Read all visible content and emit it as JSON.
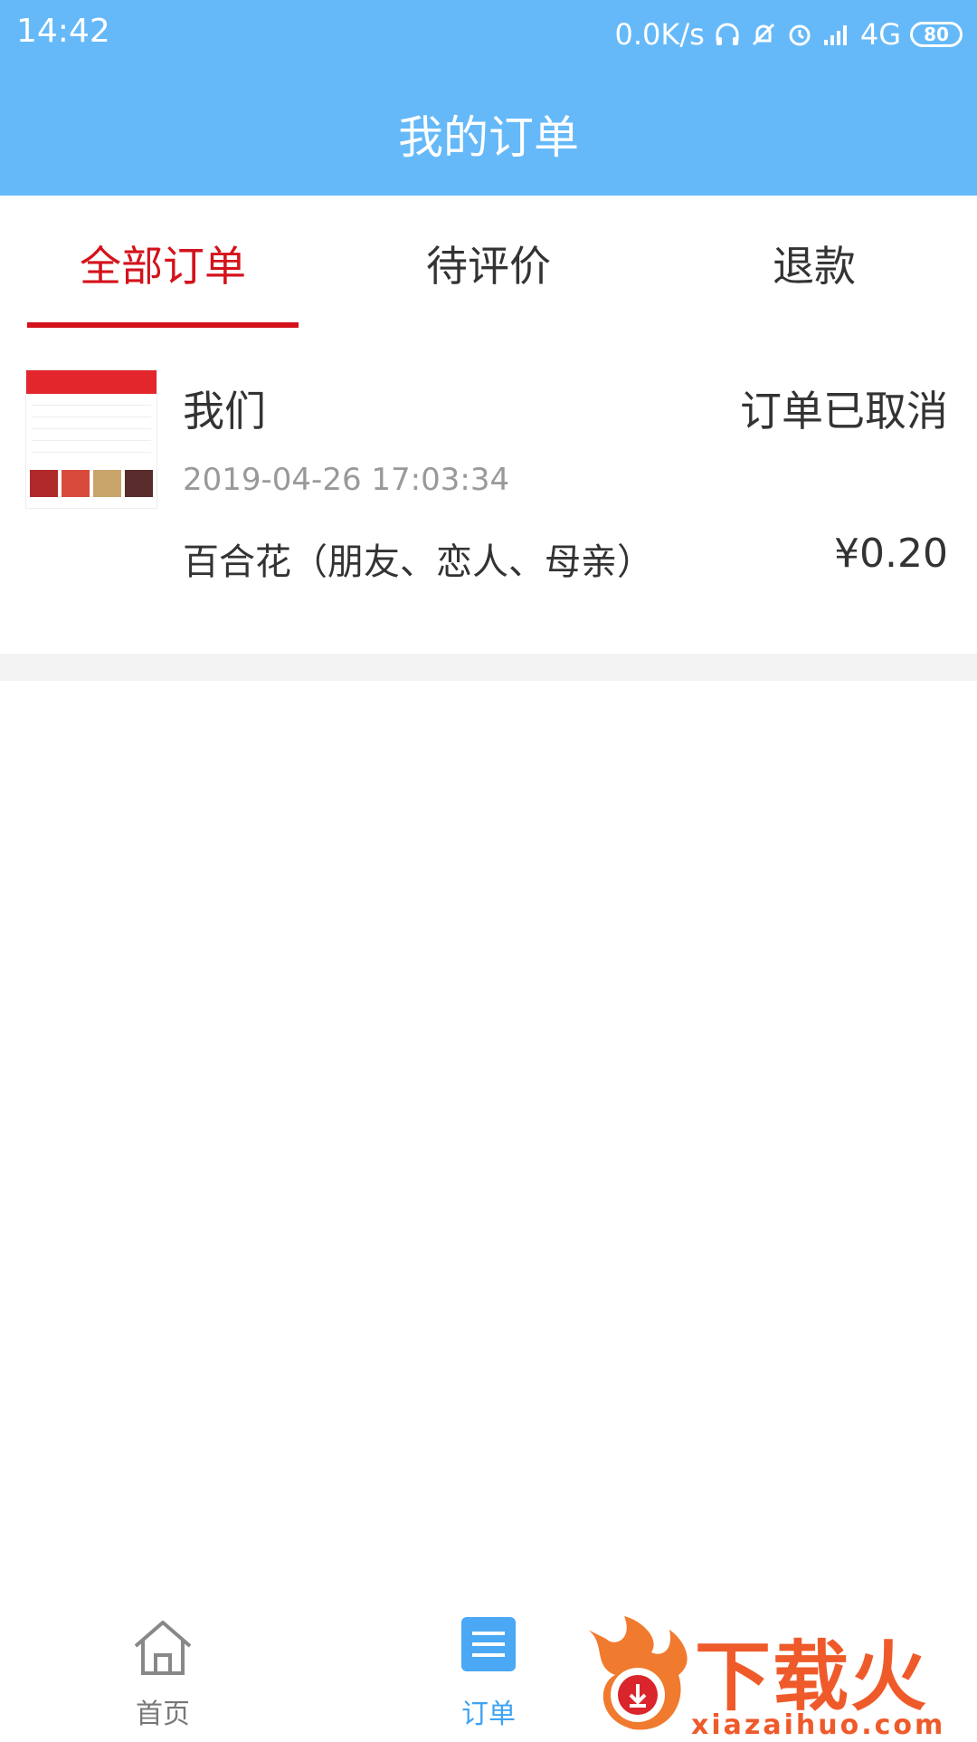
{
  "status_bar": {
    "time": "14:42",
    "speed": "0.0K/s",
    "network": "4G",
    "battery": "80"
  },
  "header": {
    "title": "我的订单"
  },
  "tabs": [
    {
      "label": "全部订单",
      "active": true
    },
    {
      "label": "待评价",
      "active": false
    },
    {
      "label": "退款",
      "active": false
    }
  ],
  "orders": [
    {
      "shop": "我们",
      "status": "订单已取消",
      "datetime": "2019-04-26 17:03:34",
      "product": "百合花（朋友、恋人、母亲）",
      "price": "¥0.20"
    }
  ],
  "bottom_nav": [
    {
      "label": "首页",
      "icon": "home-icon",
      "active": false
    },
    {
      "label": "订单",
      "icon": "list-icon",
      "active": true
    }
  ],
  "watermark": {
    "text": "下载火",
    "url": "xiazaihuo.com"
  },
  "colors": {
    "header": "#66b9f8",
    "accent": "#d4121b",
    "nav_active": "#3ea3f4"
  }
}
